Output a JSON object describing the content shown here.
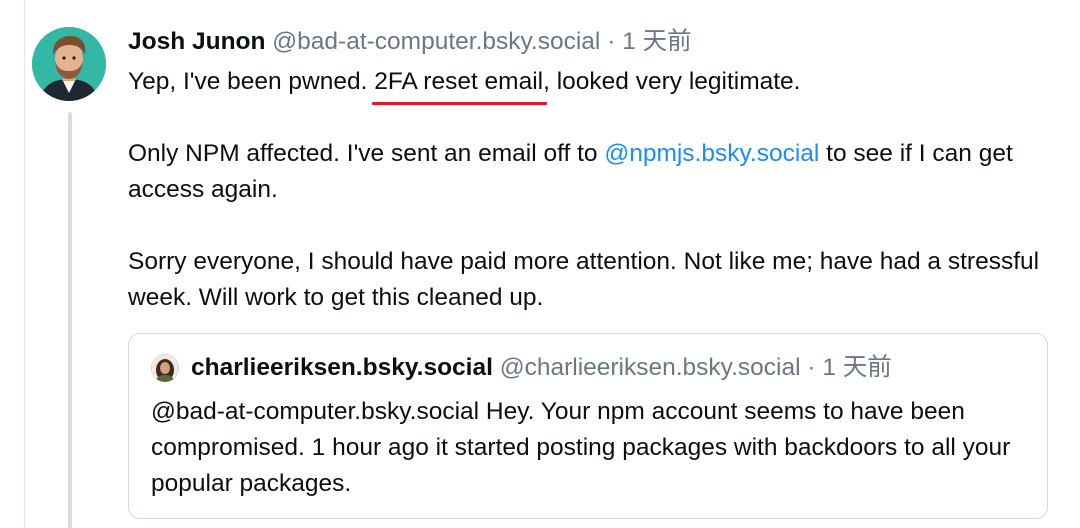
{
  "post": {
    "display_name": "Josh Junon",
    "handle": "@bad-at-computer.bsky.social",
    "separator": "·",
    "timestamp": "1 天前",
    "p1_before": "Yep, I've been pwned. ",
    "p1_highlight": "2FA reset email",
    "p1_after": ", looked very legitimate.",
    "p2_before": "Only NPM affected. I've sent an email off to ",
    "p2_mention": "@npmjs.bsky.social",
    "p2_after": " to see if I can get access again.",
    "p3": "Sorry everyone, I should have paid more attention. Not like me; have had a stressful week. Will work to get this cleaned up."
  },
  "quote": {
    "display_name": "charlieeriksen.bsky.social",
    "handle": "@charlieeriksen.bsky.social",
    "separator": "·",
    "timestamp": "1 天前",
    "body": "@bad-at-computer.bsky.social Hey. Your npm account seems to have been compromised. 1 hour ago it started posting packages with backdoors to all your popular packages."
  },
  "colors": {
    "link": "#1a8cff",
    "annotation_underline": "#e8132a",
    "muted": "#6b7785"
  }
}
